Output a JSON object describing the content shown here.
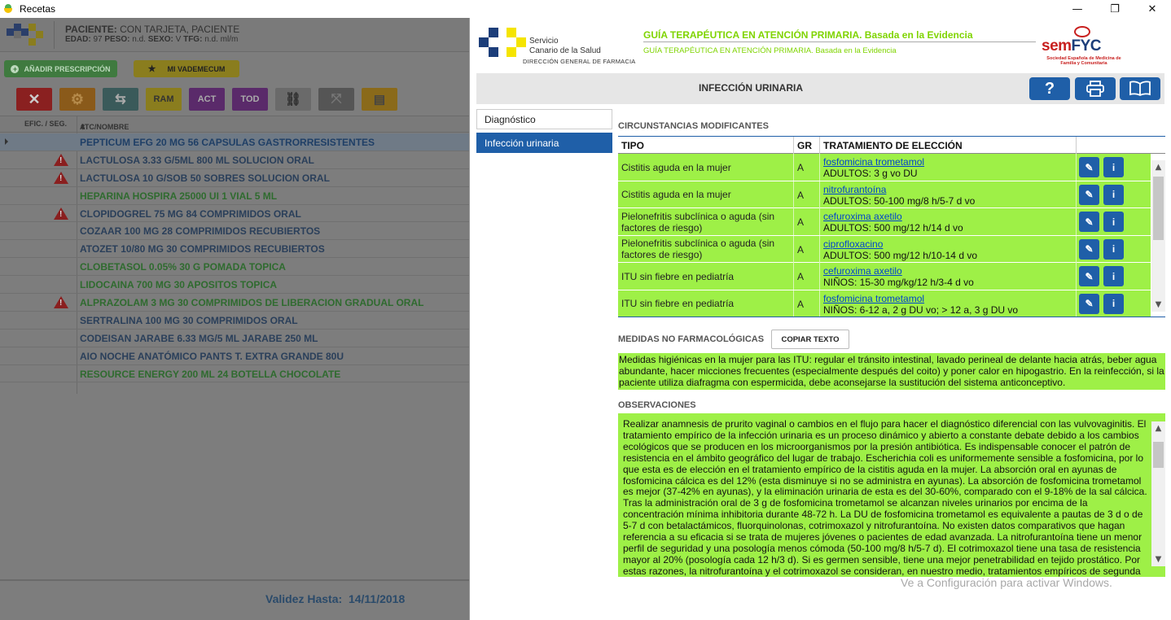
{
  "window": {
    "title": "Recetas",
    "minimize": "—",
    "maximize": "❐",
    "close": "✕"
  },
  "patient": {
    "label_paciente": "PACIENTE:",
    "name": "CON TARJETA, PACIENTE",
    "label_edad": "EDAD:",
    "edad": "97",
    "label_peso": "PESO:",
    "peso": "n.d.",
    "label_sexo": "SEXO:",
    "sexo": "V",
    "label_tfg": "TFG:",
    "tfg": "n.d. ml/m"
  },
  "actions": {
    "add": "AÑADIR PRESCRIPCIÓN",
    "vademecum": "MI VADEMECUM"
  },
  "toolbar": {
    "ram": "RAM",
    "act": "ACT",
    "tod": "TOD"
  },
  "grid": {
    "col_efic": "EFIC. / SEG.",
    "col_atc": "ATC/NOMBRE",
    "rows": [
      {
        "name": "PEPTICUM EFG 20 MG 56 CAPSULAS GASTRORRESISTENTES",
        "color": "#1f3f66",
        "warn": false,
        "selected": true
      },
      {
        "name": "LACTULOSA 3.33 G/5ML 800 ML SOLUCION ORAL",
        "color": "#2a3f5a",
        "warn": true
      },
      {
        "name": "LACTULOSA 10 G/SOB 50 SOBRES SOLUCION ORAL",
        "color": "#2a3f5a",
        "warn": true
      },
      {
        "name": "HEPARINA HOSPIRA 25000 UI 1 VIAL 5 ML",
        "color": "#2f6b2f",
        "warn": false
      },
      {
        "name": "CLOPIDOGREL 75 MG 84 COMPRIMIDOS ORAL",
        "color": "#2a3f5a",
        "warn": true
      },
      {
        "name": "COZAAR 100 MG 28 COMPRIMIDOS RECUBIERTOS",
        "color": "#2a3f5a",
        "warn": false
      },
      {
        "name": "ATOZET 10/80 MG 30 COMPRIMIDOS RECUBIERTOS",
        "color": "#2a3f5a",
        "warn": false
      },
      {
        "name": "CLOBETASOL 0.05% 30 G POMADA TOPICA",
        "color": "#2f6b2f",
        "warn": false
      },
      {
        "name": "LIDOCAINA 700 MG 30 APOSITOS TOPICA",
        "color": "#2f6b2f",
        "warn": false
      },
      {
        "name": "ALPRAZOLAM 3 MG 30 COMPRIMIDOS DE LIBERACION GRADUAL ORAL",
        "color": "#2f6b2f",
        "warn": true
      },
      {
        "name": "SERTRALINA 100 MG 30 COMPRIMIDOS ORAL",
        "color": "#2a3f5a",
        "warn": false
      },
      {
        "name": "CODEISAN JARABE 6.33 MG/5 ML JARABE 250 ML",
        "color": "#2a3f5a",
        "warn": false
      },
      {
        "name": "AIO NOCHE ANATÓMICO PANTS T. EXTRA GRANDE 80U",
        "color": "#2a3f5a",
        "warn": false
      },
      {
        "name": "RESOURCE ENERGY 200 ML 24 BOTELLA CHOCOLATE",
        "color": "#2f6b2f",
        "warn": false
      }
    ]
  },
  "footer": {
    "validez_label": "Validez Hasta:",
    "validez_date": "14/11/2018"
  },
  "guide": {
    "scs_line1": "Servicio",
    "scs_line2": "Canario de la Salud",
    "scs_sub": "DIRECCIÓN GENERAL DE FARMACIA",
    "title": "GUÍA TERAPÉUTICA EN ATENCIÓN PRIMARIA. Basada en la Evidencia",
    "subtitle": "GUÍA TERAPÉUTICA EN ATENCIÓN PRIMARIA. Basada en la Evidencia",
    "semfyc_a": "sem",
    "semfyc_b": "FYC",
    "semfyc_tiny": "Sociedad Española de Medicina de Familia y Comunitaria",
    "section_title": "INFECCIÓN URINARIA",
    "help": "?",
    "nav": [
      "Diagnóstico",
      "Infección urinaria"
    ],
    "circ_title": "CIRCUNSTANCIAS MODIFICANTES",
    "col_tipo": "TIPO",
    "col_gr": "GR",
    "col_trat": "TRATAMIENTO DE ELECCIÓN",
    "edit_icon": "✎",
    "info_icon": "i",
    "rows": [
      {
        "tipo": "Cistitis aguda en la mujer",
        "gr": "A",
        "drug": "fosfomicina trometamol",
        "dose": "ADULTOS: 3 g vo DU"
      },
      {
        "tipo": "Cistitis aguda en la mujer",
        "gr": "A",
        "drug": "nitrofurantoína",
        "dose": "ADULTOS: 50-100 mg/8 h/5-7 d vo"
      },
      {
        "tipo": "Pielonefritis subclínica o aguda (sin factores de riesgo)",
        "gr": "A",
        "drug": "cefuroxima axetilo",
        "dose": "ADULTOS: 500 mg/12 h/14 d vo"
      },
      {
        "tipo": "Pielonefritis subclínica o aguda (sin factores de riesgo)",
        "gr": "A",
        "drug": "ciprofloxacino",
        "dose": "ADULTOS: 500 mg/12 h/10-14 d vo"
      },
      {
        "tipo": "ITU sin fiebre en pediatría",
        "gr": "A",
        "drug": "cefuroxima axetilo",
        "dose": "NIÑOS: 15-30 mg/kg/12 h/3-4 d vo"
      },
      {
        "tipo": "ITU sin fiebre en pediatría",
        "gr": "A",
        "drug": "fosfomicina trometamol",
        "dose": "NIÑOS: 6-12 a, 2 g DU vo; > 12 a, 3 g DU vo"
      }
    ],
    "medidas_title": "MEDIDAS NO FARMACOLÓGICAS",
    "copy_btn": "COPIAR TEXTO",
    "medidas_text": "Medidas higiénicas en la mujer para las ITU: regular el tránsito intestinal, lavado perineal de delante hacia atrás, beber agua abundante, hacer micciones frecuentes (especialmente después del coito) y poner calor en hipogastrio. En la reinfección, si la paciente utiliza diafragma con espermicida, debe aconsejarse la sustitución del sistema anticonceptivo.",
    "obs_title": "OBSERVACIONES",
    "obs_text": "Realizar anamnesis de prurito vaginal o cambios en el flujo para hacer el diagnóstico diferencial con las vulvovaginitis. El tratamiento empírico de la infección urinaria es un proceso dinámico y abierto a constante debate debido a los cambios ecológicos que se producen en los microorganismos por la presión antibiótica. Es indispensable conocer el patrón de resistencia en el ámbito geográfico del lugar de trabajo. Escherichia coli es uniformemente sensible a fosfomicina, por lo que esta es de elección en el tratamiento empírico de la cistitis aguda en la mujer. La absorción oral en ayunas de fosfomicina cálcica es del 12% (esta disminuye si no se administra en ayunas). La absorción de fosfomicina trometamol es mejor (37-42% en ayunas), y la eliminación urinaria de esta es del 30-60%, comparado con el 9-18% de la sal cálcica. Tras la administración oral de 3 g de fosfomicina trometamol se alcanzan niveles urinarios por encima de la concentración mínima inhibitoria durante 48-72 h. La DU de fosfomicina trometamol es equivalente a pautas de 3 d o de 5-7 d con betalactámicos, fluorquinolonas, cotrimoxazol y nitrofurantoína. No existen datos comparativos que hagan referencia a su eficacia si se trata de mujeres jóvenes o pacientes de edad avanzada. La nitrofurantoína tiene un menor perfil de seguridad y una posología menos cómoda (50-100 mg/8 h/5-7 d). El cotrimoxazol tiene una tasa de resistencia mayor al 20% (posología cada 12 h/3 d). Si es germen sensible, tiene una mejor penetrabilidad en tejido prostático. Por estas razones, la nitrofurantoína y el cotrimoxazol se consideran, en nuestro medio, tratamientos empíricos de segunda",
    "scroll_up": "▲",
    "scroll_down": "▼"
  },
  "watermark": "Ve a Configuración para activar Windows."
}
